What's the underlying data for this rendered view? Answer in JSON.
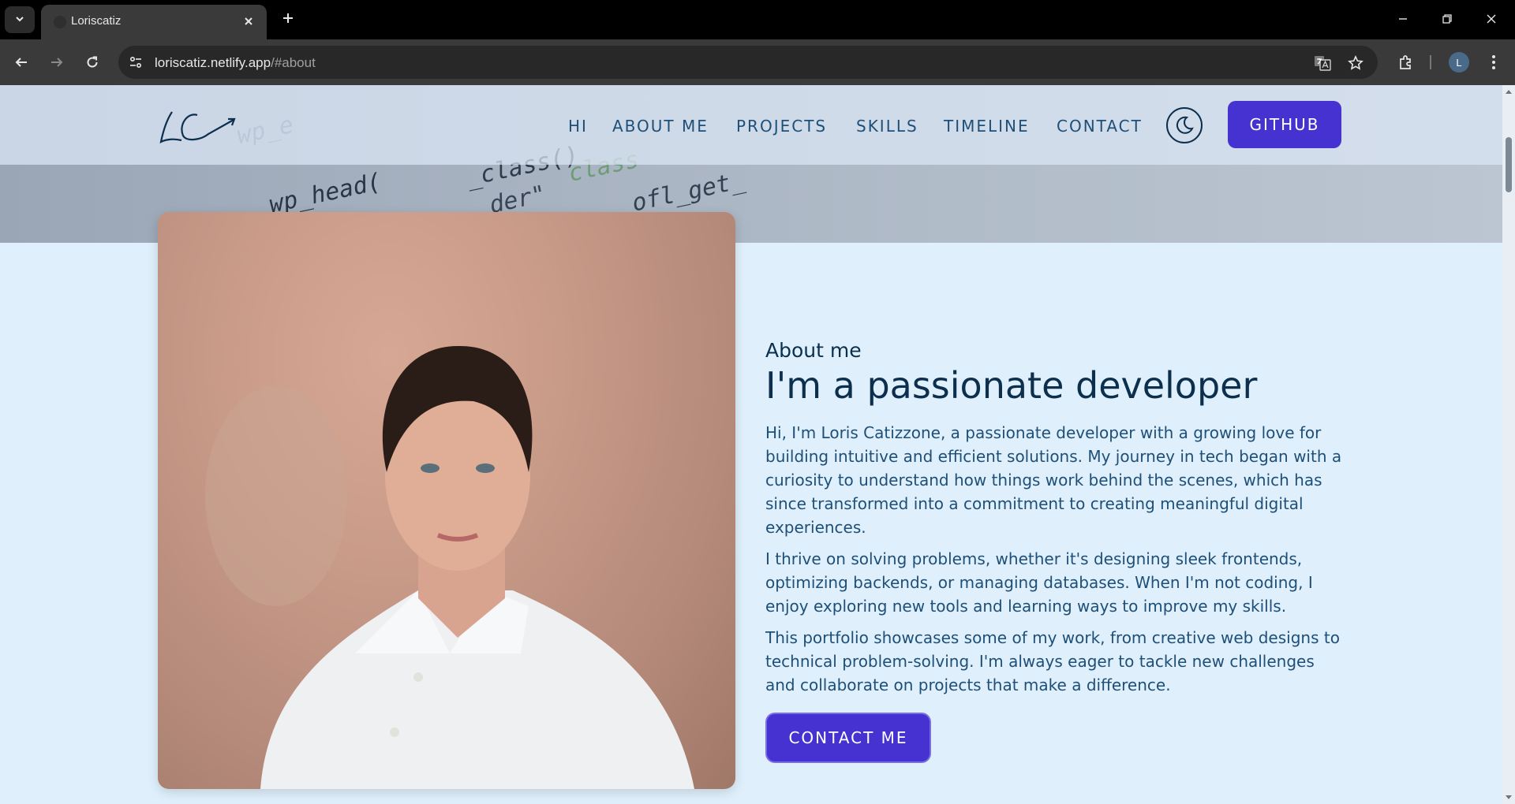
{
  "browser": {
    "tab_title": "Loriscatiz",
    "url_host": "loriscatiz.netlify.app",
    "url_path": "/#about",
    "profile_initial": "L"
  },
  "nav": {
    "logo_text": "LC",
    "links": [
      "HI",
      "ABOUT ME",
      "PROJECTS",
      "SKILLS",
      "TIMELINE",
      "CONTACT"
    ],
    "github_label": "GITHUB"
  },
  "about": {
    "eyebrow": "About me",
    "heading": "I'm a passionate developer",
    "paragraphs": [
      "Hi, I'm Loris Catizzone, a passionate developer with a growing love for building intuitive and efficient solutions. My journey in tech began with a curiosity to understand how things work behind the scenes, which has since transformed into a commitment to creating meaningful digital experiences.",
      "I thrive on solving problems, whether it's designing sleek frontends, optimizing backends, or managing databases. When I'm not coding, I enjoy exploring new tools and learning ways to improve my skills.",
      "This portfolio showcases some of my work, from creative web designs to technical problem-solving. I'm always eager to tackle new challenges and collaborate on projects that make a difference."
    ],
    "cta_label": "CONTACT ME"
  },
  "hero_code_fragments": [
    "wp_head(",
    "_class()",
    "der\"",
    "class",
    "ofl_get_",
    "wp_e"
  ],
  "icons": {
    "tab_menu": "chevron-down-icon",
    "tab_close": "close-icon",
    "new_tab": "plus-icon",
    "back": "arrow-left-icon",
    "forward": "arrow-right-icon",
    "reload": "reload-icon",
    "site_info": "tune-icon",
    "translate": "translate-icon",
    "bookmark": "star-icon",
    "extensions": "puzzle-icon",
    "menu": "kebab-menu-icon",
    "theme": "moon-icon"
  },
  "colors": {
    "accent": "#4631d1",
    "text_dark": "#0c2f4d",
    "text_body": "#1e4f78",
    "page_bg": "#dff0fc"
  }
}
